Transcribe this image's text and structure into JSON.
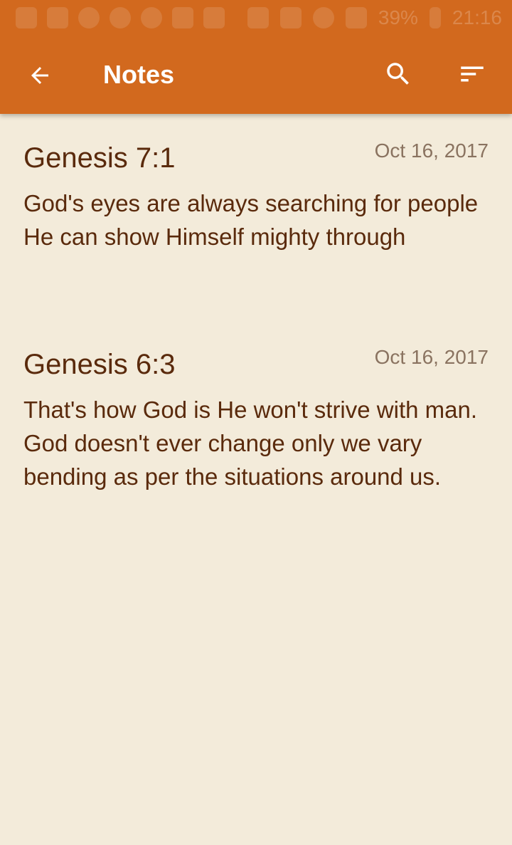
{
  "status_bar": {
    "battery": "39%",
    "time": "21:16",
    "notification_icons": [
      "dropbox-icon",
      "book-icon",
      "podcast-icon",
      "puzzle-icon",
      "at-icon",
      "book-icon",
      "quote-icon"
    ],
    "system_icons": [
      "nfc-icon",
      "mute-icon",
      "wifi-icon",
      "sim-icon",
      "signal-icon",
      "battery-icon"
    ]
  },
  "toolbar": {
    "title": "Notes",
    "back_icon": "arrow-back-icon",
    "search_icon": "search-icon",
    "sort_icon": "sort-icon"
  },
  "notes": [
    {
      "title": "Genesis 7:1",
      "date": "Oct 16, 2017",
      "body": "God's eyes are always searching for people He can show Himself mighty through"
    },
    {
      "title": "Genesis 6:3",
      "date": "Oct 16, 2017",
      "body": "That's how God is He won't strive with man. God doesn't ever change only we vary bending as per the situations around us."
    }
  ],
  "colors": {
    "app_bar": "#d2691e",
    "background": "#f3ebda",
    "text_primary": "#5a2a0c",
    "text_secondary": "#8a7360"
  }
}
